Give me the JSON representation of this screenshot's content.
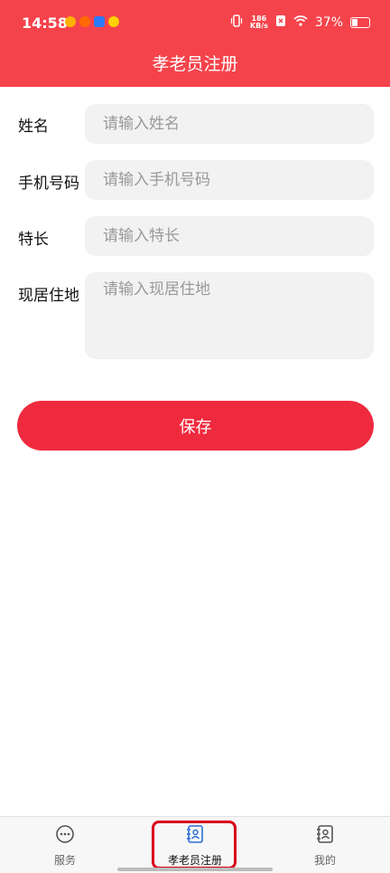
{
  "status": {
    "time": "14:58",
    "net_speed_top": "186",
    "net_speed_bottom": "KB/s",
    "battery": "37%"
  },
  "header": {
    "title": "孝老员注册"
  },
  "form": {
    "name_label": "姓名",
    "name_placeholder": "请输入姓名",
    "phone_label": "手机号码",
    "phone_placeholder": "请输入手机号码",
    "skill_label": "特长",
    "skill_placeholder": "请输入特长",
    "address_label": "现居住地",
    "address_placeholder": "请输入现居住地"
  },
  "save_label": "保存",
  "tabbar": {
    "items": [
      {
        "label": "服务",
        "icon": "chat-bubble-icon"
      },
      {
        "label": "孝老员注册",
        "icon": "contact-book-icon"
      },
      {
        "label": "我的",
        "icon": "contact-book-icon"
      }
    ],
    "active_index": 1
  },
  "colors": {
    "header": "#f5434b",
    "save_button": "#ef2a3e",
    "active_tab": "#2f6fd6",
    "highlight": "#d9001b"
  }
}
